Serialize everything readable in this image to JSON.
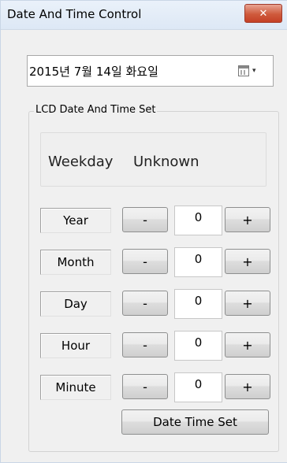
{
  "window": {
    "title": "Date And Time Control",
    "close_label": "✕"
  },
  "date_picker": {
    "value": "2015년  7월 14일 화요일",
    "icon": "calendar-icon",
    "dropdown_icon": "▾"
  },
  "group": {
    "label": "LCD Date And Time Set"
  },
  "weekday": {
    "label": "Weekday",
    "value": "Unknown"
  },
  "fields": [
    {
      "label": "Year",
      "value": "0",
      "minus": "-",
      "plus": "+"
    },
    {
      "label": "Month",
      "value": "0",
      "minus": "-",
      "plus": "+"
    },
    {
      "label": "Day",
      "value": "0",
      "minus": "-",
      "plus": "+"
    },
    {
      "label": "Hour",
      "value": "0",
      "minus": "-",
      "plus": "+"
    },
    {
      "label": "Minute",
      "value": "0",
      "minus": "-",
      "plus": "+"
    }
  ],
  "actions": {
    "set_label": "Date  Time Set"
  },
  "colors": {
    "close_button": "#c44026",
    "background": "#f0f0f0"
  }
}
